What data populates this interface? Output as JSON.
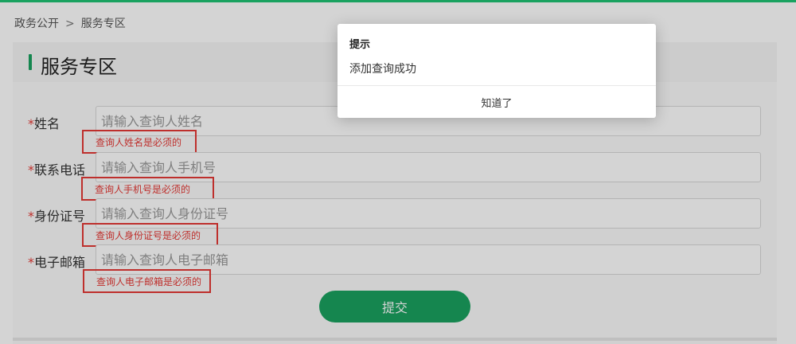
{
  "breadcrumb": {
    "parent": "政务公开",
    "separator": ">",
    "current": "服务专区"
  },
  "panel": {
    "title": "服务专区"
  },
  "form": {
    "required_mark": "*",
    "fields": [
      {
        "label": "姓名",
        "placeholder": "请输入查询人姓名",
        "value": "",
        "error": "查询人姓名是必须的"
      },
      {
        "label": "联系电话",
        "placeholder": "请输入查询人手机号",
        "value": "",
        "error": "查询人手机号是必须的"
      },
      {
        "label": "身份证号",
        "placeholder": "请输入查询人身份证号",
        "value": "",
        "error": "查询人身份证号是必须的"
      },
      {
        "label": "电子邮箱",
        "placeholder": "请输入查询人电子邮箱",
        "value": "",
        "error": "查询人电子邮箱是必须的"
      }
    ],
    "submit_label": "提交"
  },
  "dialog": {
    "title": "提示",
    "message": "添加查询成功",
    "ok_label": "知道了"
  },
  "colors": {
    "accent": "#1aa260",
    "error": "#e53935"
  }
}
